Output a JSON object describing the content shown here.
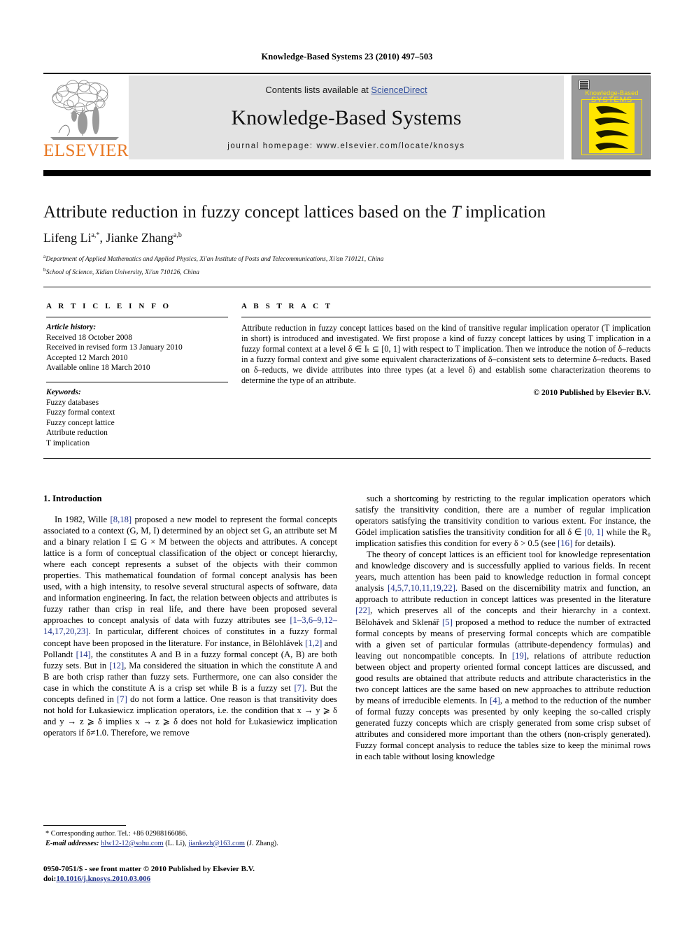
{
  "running_head": "Knowledge-Based Systems 23 (2010) 497–503",
  "masthead": {
    "contents_prefix": "Contents lists available at ",
    "sciencedirect": "ScienceDirect",
    "journal_name": "Knowledge-Based Systems",
    "homepage": "journal homepage: www.elsevier.com/locate/knosys",
    "publisher_logo_text": "ELSEVIER",
    "cover_title_line1": "Knowledge-Based",
    "cover_title_line2": "SYSTEMS",
    "accent_orange": "#E87722",
    "link_blue": "#2b4a9b",
    "cover_yellow": "#ffe600",
    "banner_gray": "#e3e3e3"
  },
  "article": {
    "title_plain_1": "Attribute reduction in fuzzy concept lattices based on the ",
    "title_italic": "T",
    "title_plain_2": " implication",
    "authors": "Lifeng Li",
    "author_sup_1": "a,*",
    "authors_2": ", Jianke Zhang",
    "author_sup_2": "a,b",
    "affiliation_a_sup": "a",
    "affiliation_a": "Department of Applied Mathematics and Applied Physics, Xi'an Institute of Posts and Telecommunications, Xi'an 710121, China",
    "affiliation_b_sup": "b",
    "affiliation_b": "School of Science, Xidian University, Xi'an 710126, China"
  },
  "info": {
    "heading": "A R T I C L E   I N F O",
    "history_label": "Article history:",
    "history": [
      "Received 18 October 2008",
      "Received in revised form 13 January 2010",
      "Accepted 12 March 2010",
      "Available online 18 March 2010"
    ],
    "keywords_label": "Keywords:",
    "keywords": [
      "Fuzzy databases",
      "Fuzzy formal context",
      "Fuzzy concept lattice",
      "Attribute reduction",
      "T implication"
    ]
  },
  "abstract": {
    "heading": "A B S T R A C T",
    "text": "Attribute reduction in fuzzy concept lattices based on the kind of transitive regular implication operator (T implication in short) is introduced and investigated. We first propose a kind of fuzzy concept lattices by using T implication in a fuzzy formal context at a level δ ∈ Iₜ ⊆ [0, 1] with respect to T implication. Then we introduce the notion of δ–reducts in a fuzzy formal context and give some equivalent characterizations of δ–consistent sets to determine δ–reducts. Based on δ–reducts, we divide attributes into three types (at a level δ) and establish some characterization theorems to determine the type of an attribute.",
    "copyright": "© 2010 Published by Elsevier B.V."
  },
  "body": {
    "section_heading": "1. Introduction",
    "left_paragraph_1": "In 1982, Wille [8,18] proposed a new model to represent the formal concepts associated to a context (G, M, I) determined by an object set G, an attribute set M and a binary relation I ⊆ G × M between the objects and attributes. A concept lattice is a form of conceptual classification of the object or concept hierarchy, where each concept represents a subset of the objects with their common properties. This mathematical foundation of formal concept analysis has been used, with a high intensity, to resolve several structural aspects of software, data and information engineering. In fact, the relation between objects and attributes is fuzzy rather than crisp in real life, and there have been proposed several approaches to concept analysis of data with fuzzy attributes see [1–3,6–9,12–14,17,20,23]. In particular, different choices of constitutes in a fuzzy formal concept have been proposed in the literature. For instance, in Bĕlohlávek [1,2] and Pollandt [14], the constitutes A and B in a fuzzy formal concept (A, B) are both fuzzy sets. But in [12], Ma considered the situation in which the constitute A and B are both crisp rather than fuzzy sets. Furthermore, one can also consider the case in which the constitute A is a crisp set while B is a fuzzy set [7]. But the concepts defined in [7] do not form a lattice. One reason is that transitivity does not hold for Łukasiewicz implication operators, i.e. the condition that x → y ⩾ δ and y → z ⩾ δ implies x → z ⩾ δ does not hold for Łukasiewicz implication operators if δ≠1.0. Therefore, we remove",
    "right_paragraph_1": "such a shortcoming by restricting to the regular implication operators which satisfy the transitivity condition, there are a number of regular implication operators satisfying the transitivity condition to various extent. For instance, the Gödel implication satisfies the transitivity condition for all δ ∈ [0, 1] while the R₀ implication satisfies this condition for every δ > 0.5 (see [16] for details).",
    "right_paragraph_2": "The theory of concept lattices is an efficient tool for knowledge representation and knowledge discovery and is successfully applied to various fields. In recent years, much attention has been paid to knowledge reduction in formal concept analysis [4,5,7,10,11,19,22]. Based on the discernibility matrix and function, an approach to attribute reduction in concept lattices was presented in the literature [22], which preserves all of the concepts and their hierarchy in a context. Bĕlohávek and Sklenář [5] proposed a method to reduce the number of extracted formal concepts by means of preserving formal concepts which are compatible with a given set of particular formulas (attribute-dependency formulas) and leaving out noncompatible concepts. In [19], relations of attribute reduction between object and property oriented formal concept lattices are discussed, and good results are obtained that attribute reducts and attribute characteristics in the two concept lattices are the same based on new approaches to attribute reduction by means of irreducible elements. In [4], a method to the reduction of the number of formal fuzzy concepts was presented by only keeping the so-called crisply generated fuzzy concepts which are crisply generated from some crisp subset of attributes and considered more important than the others (non-crisply generated). Fuzzy formal concept analysis to reduce the tables size to keep the minimal rows in each table without losing knowledge"
  },
  "footnotes": {
    "corresponding": "* Corresponding author. Tel.: +86 02988166086.",
    "email_label": "E-mail addresses:",
    "email_1": "hlw12-12@sohu.com",
    "email_1_owner": " (L. Li), ",
    "email_2": "jiankezh@163.com",
    "email_2_owner": " (J. Zhang).",
    "issn_line": "0950-7051/$ - see front matter © 2010 Published by Elsevier B.V.",
    "doi_label": "doi:",
    "doi_value": "10.1016/j.knosys.2010.03.006"
  }
}
